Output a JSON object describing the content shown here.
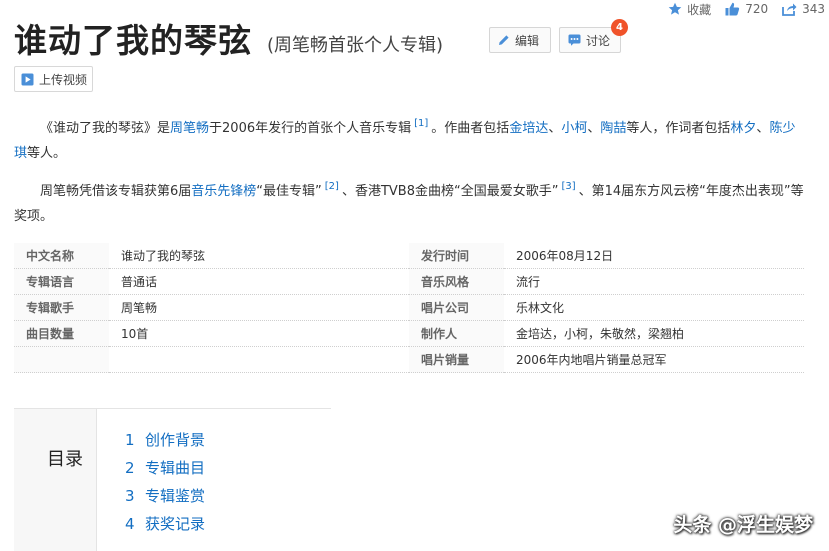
{
  "stats": {
    "favorite_label": "收藏",
    "likes": "720",
    "shares": "343"
  },
  "header": {
    "title": "谁动了我的琴弦",
    "subtitle": "(周笔畅首张个人专辑)",
    "edit_label": "编辑",
    "discuss_label": "讨论",
    "discuss_badge": "4",
    "upload_label": "上传视频"
  },
  "intro": {
    "p1": {
      "t1": "《谁动了我的琴弦》是",
      "link1": "周笔畅",
      "t2": "于2006年发行的首张个人音乐专辑",
      "ref1": "[1]",
      "t3": "。作曲者包括",
      "link2": "金培达",
      "sep1": "、",
      "link3": "小柯",
      "sep2": "、",
      "link4": "陶喆",
      "t4": "等人，作词者包括",
      "link5": "林夕",
      "sep3": "、",
      "link6": "陈少琪",
      "t5": "等人。"
    },
    "p2": {
      "t1": "周笔畅凭借该专辑获第6届",
      "link1": "音乐先锋榜",
      "t2": "“最佳专辑”",
      "ref1": "[2]",
      "t3": "、香港TVB8金曲榜“全国最爱女歌手”",
      "ref2": "[3]",
      "t4": "、第14届东方风云榜“年度杰出表现”等奖项。"
    }
  },
  "basic_info": [
    {
      "k1": "中文名称",
      "v1": "谁动了我的琴弦",
      "k2": "发行时间",
      "v2": "2006年08月12日"
    },
    {
      "k1": "专辑语言",
      "v1": "普通话",
      "k2": "音乐风格",
      "v2": "流行"
    },
    {
      "k1": "专辑歌手",
      "v1": "周笔畅",
      "k2": "唱片公司",
      "v2": "乐林文化"
    },
    {
      "k1": "曲目数量",
      "v1": "10首",
      "k2": "制作人",
      "v2": "金培达，小柯，朱敬然，梁翘柏"
    },
    {
      "k1": "",
      "v1": "",
      "k2": "唱片销量",
      "v2": "2006年内地唱片销量总冠军"
    }
  ],
  "catalog": {
    "title": "目录",
    "items": [
      {
        "num": "1",
        "label": "创作背景"
      },
      {
        "num": "2",
        "label": "专辑曲目"
      },
      {
        "num": "3",
        "label": "专辑鉴赏"
      },
      {
        "num": "4",
        "label": "获奖记录"
      }
    ]
  },
  "watermark": "头条 @浮生娱梦",
  "colors": {
    "link": "#136ec2",
    "badge": "#f0532a",
    "icon_blue": "#4a8fd8"
  }
}
